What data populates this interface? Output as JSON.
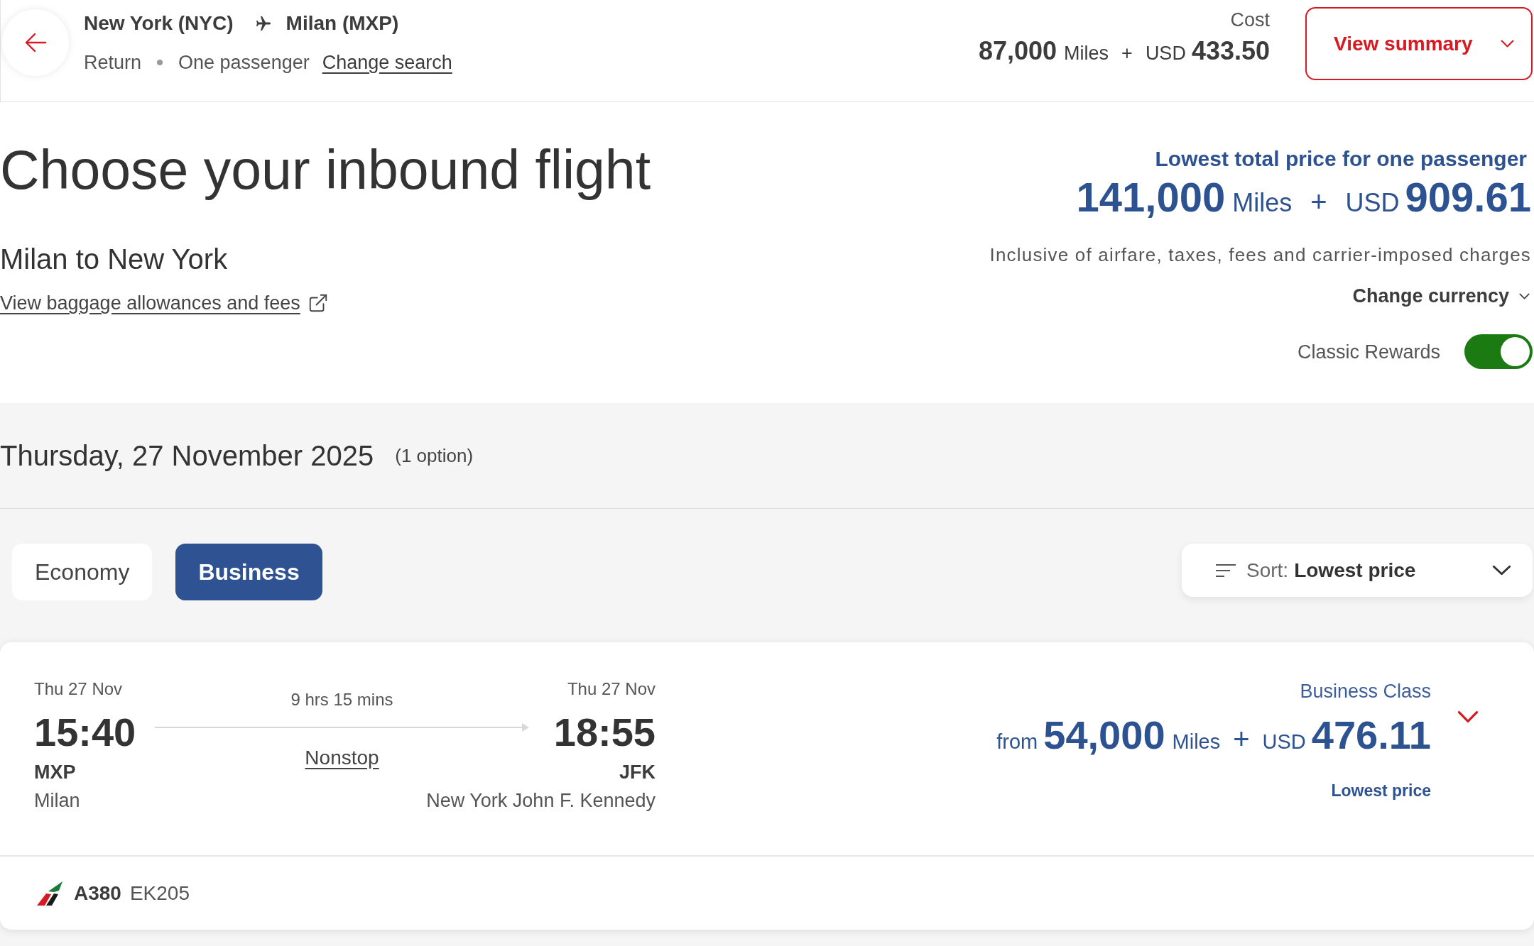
{
  "header": {
    "origin": "New York (NYC)",
    "destination": "Milan (MXP)",
    "trip_type": "Return",
    "passengers": "One passenger",
    "change_search": "Change search",
    "cost": {
      "label": "Cost",
      "miles": "87,000",
      "miles_unit": "Miles",
      "plus": "+",
      "currency": "USD",
      "amount": "433.50"
    },
    "summary_button": "View summary"
  },
  "page": {
    "title": "Choose your inbound flight",
    "subtitle": "Milan to New York",
    "baggage_link": "View baggage allowances and fees"
  },
  "price_summary": {
    "label": "Lowest total price for one passenger",
    "miles": "141,000",
    "miles_unit": "Miles",
    "plus": "+",
    "currency": "USD",
    "amount": "909.61",
    "note": "Inclusive of airfare, taxes, fees and carrier-imposed charges",
    "currency_menu": "Change currency",
    "classic_rewards": {
      "label": "Classic Rewards",
      "on": true
    }
  },
  "day": {
    "date": "Thursday, 27 November 2025",
    "options": "(1 option)"
  },
  "cabin_tabs": [
    {
      "label": "Economy",
      "selected": false
    },
    {
      "label": "Business",
      "selected": true
    }
  ],
  "sort": {
    "label": "Sort:",
    "value": "Lowest price"
  },
  "flights": [
    {
      "departure": {
        "date": "Thu 27 Nov",
        "time": "15:40",
        "code": "MXP",
        "city": "Milan"
      },
      "duration": "9 hrs 15 mins",
      "stops": "Nonstop",
      "arrival": {
        "date": "Thu 27 Nov",
        "time": "18:55",
        "code": "JFK",
        "city": "New York John F. Kennedy"
      },
      "cabin": "Business Class",
      "price": {
        "prefix": "from",
        "miles": "54,000",
        "miles_unit": "Miles",
        "plus": "+",
        "currency": "USD",
        "amount": "476.11"
      },
      "price_note": "Lowest price",
      "aircraft": "A380",
      "flight_number": "EK205"
    }
  ]
}
